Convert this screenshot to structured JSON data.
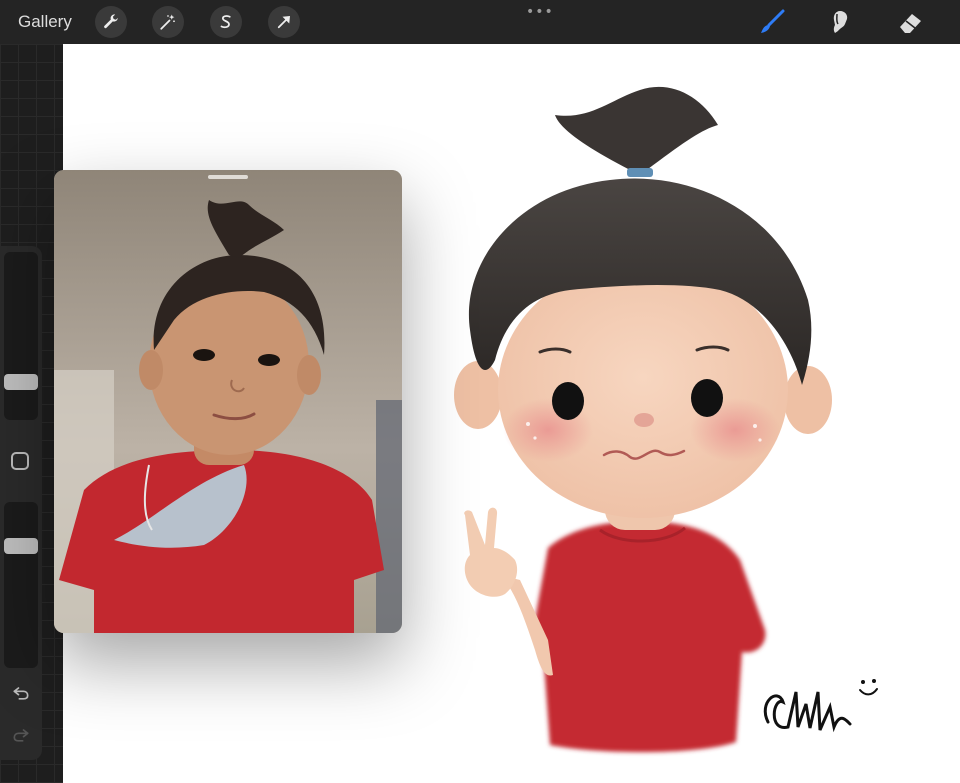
{
  "toolbar": {
    "gallery_label": "Gallery",
    "left_tools": [
      "wrench-icon",
      "magic-wand-icon",
      "selection-s-icon",
      "transform-arrow-icon"
    ],
    "more_label": "•••",
    "right_tools": [
      "brush-icon",
      "smudge-icon",
      "eraser-icon"
    ],
    "active_tool": "brush-icon",
    "accent_color": "#2e7cf6"
  },
  "sidebar": {
    "brush_size_level": 0.38,
    "opacity_level": 0.85,
    "icons": [
      "modify-square-icon",
      "undo-icon",
      "redo-icon"
    ]
  },
  "reference": {
    "subject": "photo-of-child",
    "shirt_color": "#c2282f"
  },
  "artwork": {
    "subject": "chibi-child-illustration",
    "shirt_color": "#c42a33",
    "skin_color": "#f3cdb3"
  }
}
